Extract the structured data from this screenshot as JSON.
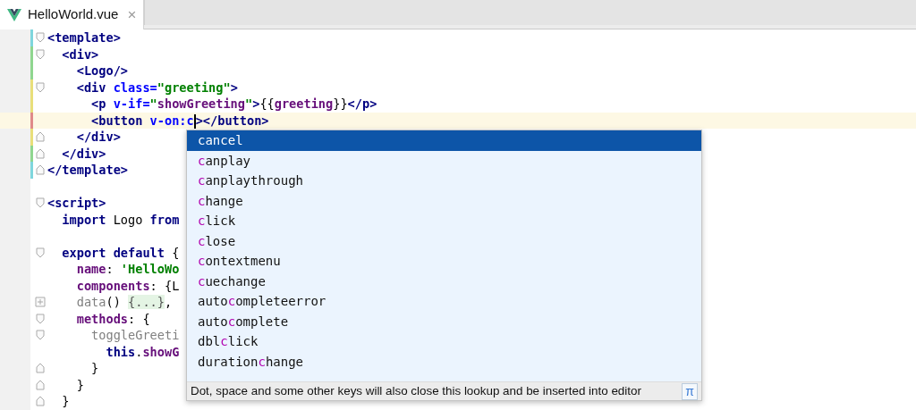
{
  "tabs": [
    {
      "label": "HelloWorld.vue",
      "selected": true,
      "close": "×"
    }
  ],
  "editor": {
    "lines": [
      {
        "color": "#7fd6dd",
        "kind": "fold-open",
        "tokens": [
          {
            "kind": "tag",
            "text": "<template>"
          }
        ]
      },
      {
        "color": "#8fd68f",
        "kind": "fold-open",
        "tokens": [
          {
            "kind": "tag",
            "text": "  <div>"
          }
        ]
      },
      {
        "color": "#8fd68f",
        "kind": "plain",
        "tokens": [
          {
            "kind": "tag",
            "text": "    <Logo/>"
          }
        ]
      },
      {
        "color": "#e8df7a",
        "kind": "fold-open",
        "tokens": [
          {
            "kind": "tag",
            "text": "    <div "
          },
          {
            "kind": "attr",
            "text": "class="
          },
          {
            "kind": "str",
            "text": "\"greeting\""
          },
          {
            "kind": "tag",
            "text": ">"
          }
        ]
      },
      {
        "color": "#e8df7a",
        "kind": "plain",
        "tokens": [
          {
            "kind": "tag",
            "text": "      <p "
          },
          {
            "kind": "attr",
            "text": "v-if="
          },
          {
            "kind": "str",
            "text": "\""
          },
          {
            "kind": "val",
            "text": "showGreeting"
          },
          {
            "kind": "str",
            "text": "\""
          },
          {
            "kind": "tag",
            "text": ">"
          },
          {
            "kind": "text",
            "text": "{{"
          },
          {
            "kind": "val",
            "text": "greeting"
          },
          {
            "kind": "text",
            "text": "}}"
          },
          {
            "kind": "tag",
            "text": "</p>"
          }
        ]
      },
      {
        "color": "#e08a8a",
        "kind": "plain",
        "current": true,
        "tokens": [
          {
            "kind": "tag",
            "text": "      <button "
          },
          {
            "kind": "attr",
            "text": "v-on:c"
          },
          {
            "kind": "caret"
          },
          {
            "kind": "tag",
            "text": "></button>"
          }
        ]
      },
      {
        "color": "#e8df7a",
        "kind": "fold-close",
        "tokens": [
          {
            "kind": "tag",
            "text": "    </div>"
          }
        ]
      },
      {
        "color": "#8fd68f",
        "kind": "fold-close",
        "tokens": [
          {
            "kind": "tag",
            "text": "  </div>"
          }
        ]
      },
      {
        "color": "#7fd6dd",
        "kind": "fold-close",
        "tokens": [
          {
            "kind": "tag",
            "text": "</template>"
          }
        ]
      },
      {
        "kind": "plain"
      },
      {
        "kind": "fold-open",
        "tokens": [
          {
            "kind": "tag",
            "text": "<script>"
          }
        ]
      },
      {
        "kind": "plain",
        "tokens": [
          {
            "kind": "kw",
            "text": "  import "
          },
          {
            "kind": "text",
            "text": "Logo "
          },
          {
            "kind": "kw",
            "text": "from"
          }
        ]
      },
      {
        "kind": "plain"
      },
      {
        "kind": "fold-open",
        "tokens": [
          {
            "kind": "kw",
            "text": "  export default "
          },
          {
            "kind": "text",
            "text": "{"
          }
        ]
      },
      {
        "kind": "plain",
        "tokens": [
          {
            "kind": "prop",
            "text": "    name"
          },
          {
            "kind": "text",
            "text": ": "
          },
          {
            "kind": "str",
            "text": "'HelloWo"
          }
        ]
      },
      {
        "kind": "plain",
        "tokens": [
          {
            "kind": "prop",
            "text": "    components"
          },
          {
            "kind": "text",
            "text": ": {L"
          }
        ]
      },
      {
        "kind": "folded",
        "tokens": [
          {
            "kind": "dim",
            "text": "    data"
          },
          {
            "kind": "text",
            "text": "() "
          },
          {
            "kind": "folded",
            "text": "{...}"
          },
          {
            "kind": "text",
            "text": ","
          }
        ]
      },
      {
        "kind": "fold-open",
        "tokens": [
          {
            "kind": "prop",
            "text": "    methods"
          },
          {
            "kind": "text",
            "text": ": {"
          }
        ]
      },
      {
        "kind": "fold-open",
        "tokens": [
          {
            "kind": "dim",
            "text": "      toggleGreeti"
          }
        ]
      },
      {
        "kind": "plain",
        "tokens": [
          {
            "kind": "kw",
            "text": "        this"
          },
          {
            "kind": "text",
            "text": "."
          },
          {
            "kind": "prop",
            "text": "showG"
          }
        ]
      },
      {
        "kind": "fold-close",
        "tokens": [
          {
            "kind": "text",
            "text": "      }"
          }
        ]
      },
      {
        "kind": "fold-close",
        "tokens": [
          {
            "kind": "text",
            "text": "    }"
          }
        ]
      },
      {
        "kind": "fold-close",
        "tokens": [
          {
            "kind": "text",
            "text": "  }"
          }
        ]
      }
    ]
  },
  "lookup": {
    "items": [
      {
        "hit": "c",
        "post": "ancel",
        "selected": true
      },
      {
        "hit": "c",
        "post": "anplay",
        "selected": false
      },
      {
        "hit": "c",
        "post": "anplaythrough",
        "selected": false
      },
      {
        "hit": "c",
        "post": "hange",
        "selected": false
      },
      {
        "hit": "c",
        "post": "lick",
        "selected": false
      },
      {
        "hit": "c",
        "post": "lose",
        "selected": false
      },
      {
        "hit": "c",
        "post": "ontextmenu",
        "selected": false
      },
      {
        "hit": "c",
        "post": "uechange",
        "selected": false
      },
      {
        "pre": "auto",
        "hit": "c",
        "post": "ompleteerror",
        "selected": false
      },
      {
        "pre": "auto",
        "hit": "c",
        "post": "omplete",
        "selected": false
      },
      {
        "pre": "dbl",
        "hit": "c",
        "post": "lick",
        "selected": false
      },
      {
        "pre": "duration",
        "hit": "c",
        "post": "hange",
        "selected": false
      }
    ],
    "hint": "Dot, space and some other keys will also close this lookup and be inserted into editor",
    "hint_button": "π"
  }
}
